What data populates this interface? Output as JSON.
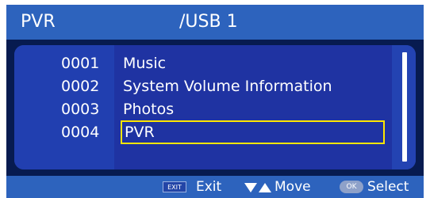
{
  "topbar": {
    "mode": "PVR",
    "path": "/USB 1"
  },
  "files": [
    {
      "number": "0001",
      "name": "Music",
      "selected": false
    },
    {
      "number": "0002",
      "name": "System Volume Information",
      "selected": false
    },
    {
      "number": "0003",
      "name": "Photos",
      "selected": false
    },
    {
      "number": "0004",
      "name": "PVR",
      "selected": true
    }
  ],
  "bottombar": {
    "exit_key": "EXIT",
    "exit_label": "Exit",
    "move_label": "Move",
    "ok_key": "OK",
    "select_label": "Select"
  },
  "colors": {
    "bar": "#2d63bd",
    "panel": "#2343b2",
    "highlight": "#ffe600",
    "background": "#071b50"
  }
}
